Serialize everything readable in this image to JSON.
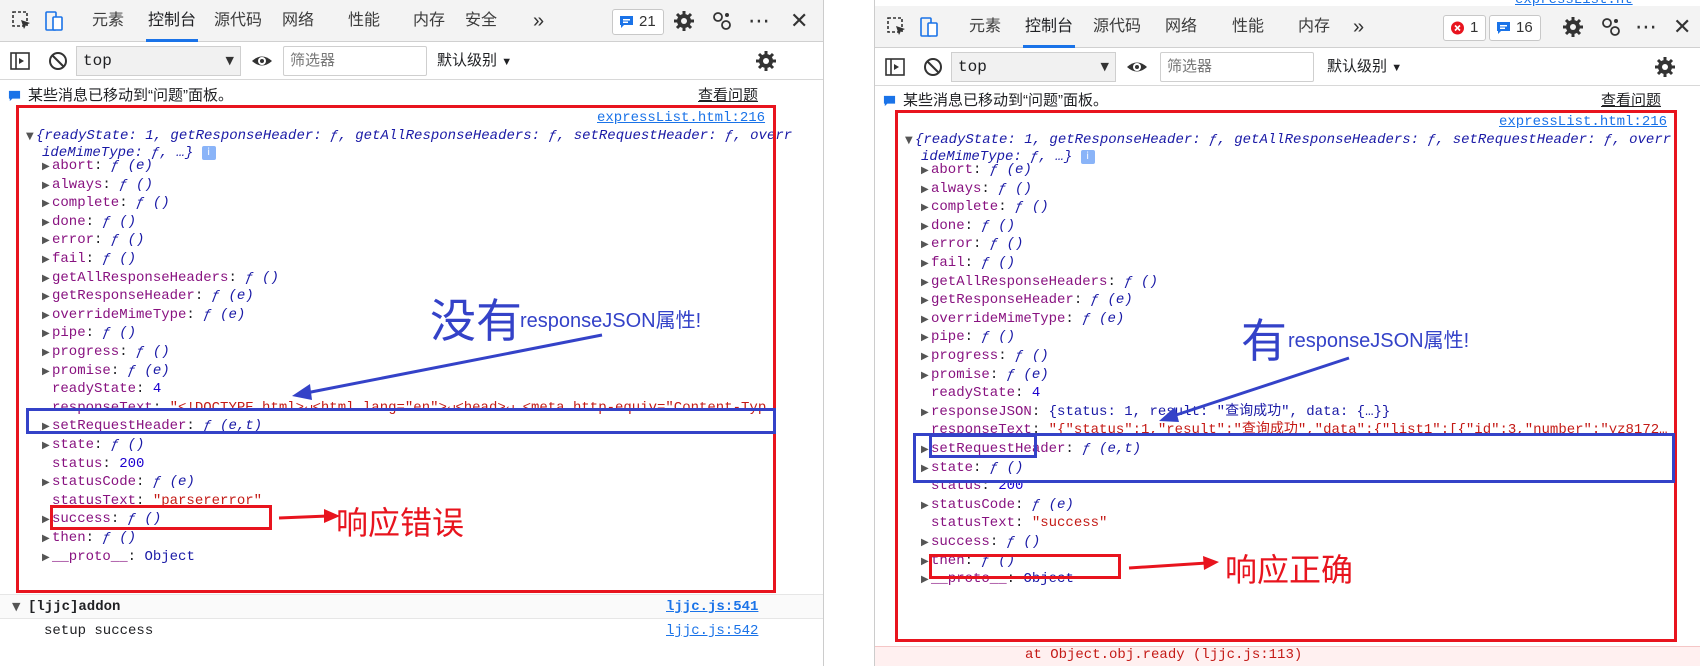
{
  "left": {
    "tabs": {
      "elements": "元素",
      "console": "控制台",
      "sources": "源代码",
      "network": "网络",
      "performance": "性能",
      "memory": "内存",
      "security": "安全",
      "more": "»"
    },
    "issues_badge": "21",
    "context": "top",
    "filter_placeholder": "筛选器",
    "level": "默认级别",
    "notice": "某些消息已移动到“问题”面板。",
    "view_issues": "查看问题",
    "source_link": "expressList.html:216",
    "summary_1": "{readyState: 1, getResponseHeader: ƒ, getAllResponseHeaders: ƒ, setRequestHeader: ƒ, overr",
    "summary_2": "ideMimeType: ƒ, …}",
    "props": [
      {
        "key": "abort",
        "val": "ƒ (e)"
      },
      {
        "key": "always",
        "val": "ƒ ()"
      },
      {
        "key": "complete",
        "val": "ƒ ()"
      },
      {
        "key": "done",
        "val": "ƒ ()"
      },
      {
        "key": "error",
        "val": "ƒ ()"
      },
      {
        "key": "fail",
        "val": "ƒ ()"
      },
      {
        "key": "getAllResponseHeaders",
        "val": "ƒ ()"
      },
      {
        "key": "getResponseHeader",
        "val": "ƒ (e)"
      },
      {
        "key": "overrideMimeType",
        "val": "ƒ (e)"
      },
      {
        "key": "pipe",
        "val": "ƒ ()"
      },
      {
        "key": "progress",
        "val": "ƒ ()"
      },
      {
        "key": "promise",
        "val": "ƒ (e)"
      },
      {
        "key": "readyState",
        "val": "4"
      },
      {
        "key": "responseText",
        "val": "\"<!DOCTYPE html>↵<html lang=\"en\">↵<head>↵    <meta http-equiv=\"Content-Typ…"
      },
      {
        "key": "setRequestHeader",
        "val": "ƒ (e,t)"
      },
      {
        "key": "state",
        "val": "ƒ ()"
      },
      {
        "key": "status",
        "val": "200"
      },
      {
        "key": "statusCode",
        "val": "ƒ (e)"
      },
      {
        "key": "statusText",
        "val": "\"parsererror\""
      },
      {
        "key": "success",
        "val": "ƒ ()"
      },
      {
        "key": "then",
        "val": "ƒ ()"
      },
      {
        "key": "__proto__",
        "val": "Object"
      }
    ],
    "anno_big": "没有",
    "anno_small": "responseJSON属性!",
    "anno_error": "响应错误",
    "group_label": "[ljjc]addon",
    "group_src": "ljjc.js:541",
    "setup_text": "setup success",
    "setup_src": "ljjc.js:542"
  },
  "right": {
    "tabs": {
      "elements": "元素",
      "console": "控制台",
      "sources": "源代码",
      "network": "网络",
      "performance": "性能",
      "memory": "内存",
      "more": "»"
    },
    "error_badge": "1",
    "issues_badge": "16",
    "context": "top",
    "filter_placeholder": "筛选器",
    "level": "默认级别",
    "notice": "某些消息已移动到“问题”面板。",
    "view_issues": "查看问题",
    "source_link": "expressList.html:216",
    "summary_1": "{readyState: 1, getResponseHeader: ƒ, getAllResponseHeaders: ƒ, setRequestHeader: ƒ, overr",
    "summary_2": "ideMimeType: ƒ, …}",
    "props": [
      {
        "key": "abort",
        "val": "ƒ (e)"
      },
      {
        "key": "always",
        "val": "ƒ ()"
      },
      {
        "key": "complete",
        "val": "ƒ ()"
      },
      {
        "key": "done",
        "val": "ƒ ()"
      },
      {
        "key": "error",
        "val": "ƒ ()"
      },
      {
        "key": "fail",
        "val": "ƒ ()"
      },
      {
        "key": "getAllResponseHeaders",
        "val": "ƒ ()"
      },
      {
        "key": "getResponseHeader",
        "val": "ƒ (e)"
      },
      {
        "key": "overrideMimeType",
        "val": "ƒ (e)"
      },
      {
        "key": "pipe",
        "val": "ƒ ()"
      },
      {
        "key": "progress",
        "val": "ƒ ()"
      },
      {
        "key": "promise",
        "val": "ƒ (e)"
      },
      {
        "key": "readyState",
        "val": "4"
      },
      {
        "key": "responseJSON",
        "val": "{status: 1, result: \"查询成功\", data: {…}}"
      },
      {
        "key": "responseText",
        "val": "\"{\"status\":1,\"result\":\"查询成功\",\"data\":{\"list1\":[{\"id\":3,\"number\":\"yz8172…"
      },
      {
        "key": "setRequestHeader",
        "val": "ƒ (e,t)"
      },
      {
        "key": "state",
        "val": "ƒ ()"
      },
      {
        "key": "status",
        "val": "200"
      },
      {
        "key": "statusCode",
        "val": "ƒ (e)"
      },
      {
        "key": "statusText",
        "val": "\"success\""
      },
      {
        "key": "success",
        "val": "ƒ ()"
      },
      {
        "key": "then",
        "val": "ƒ ()"
      },
      {
        "key": "__proto__",
        "val": "Object"
      }
    ],
    "anno_big": "有",
    "anno_small": "responseJSON属性!",
    "anno_success": "响应正确",
    "bottom_partial": "at Object.obj.ready (ljjc.js:113)",
    "top_cut_link": "expressList.ht"
  },
  "colors": {
    "red_box": "#e8141e",
    "blue_box": "#3442c8",
    "link": "#1a73e8",
    "key": "#881280",
    "string": "#c41a16",
    "number": "#1c00cf"
  }
}
